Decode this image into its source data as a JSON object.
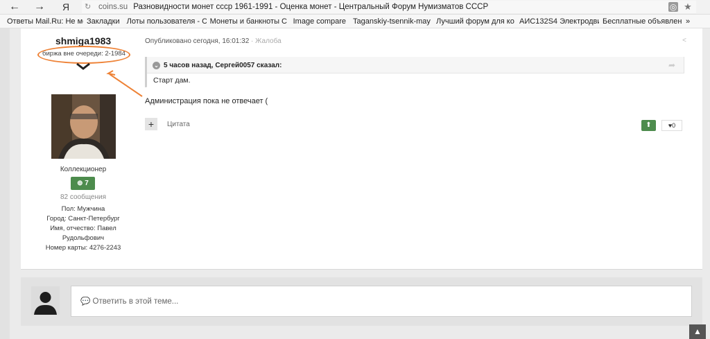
{
  "browser": {
    "back": "←",
    "forward": "→",
    "yandex": "Я",
    "reload": "↻",
    "domain": "coins.su",
    "title": "Разновидности монет ссср 1961-1991 - Оценка монет - Центральный Форум Нумизматов СССР",
    "addon_icon": "◎",
    "star_icon": "★"
  },
  "bookmarks": [
    "Ответы Mail.Ru: Не мо",
    "Закладки",
    "Лоты пользователя - С",
    "Монеты и банкноты С",
    "Image compare",
    "Taganskiy-tsennik-may",
    "Лучший форум для ко",
    "АИС132S4 Электродви",
    "Бесплатные объявлен",
    "»"
  ],
  "author": {
    "username": "shmiga1983",
    "title": "биржа вне очереди: 2-1984",
    "group": "Коллекционер",
    "reputation": "7",
    "posts": "82 сообщения",
    "fields": [
      {
        "label": "Пол:",
        "value": "Мужчина"
      },
      {
        "label": "Город:",
        "value": "Санкт-Петербург"
      },
      {
        "label": "Имя, отчество:",
        "value": "Павел Рудольфович"
      },
      {
        "label": "Номер карты:",
        "value": "4276-2243"
      }
    ]
  },
  "post": {
    "published": "Опубликовано сегодня, 16:01:32",
    "separator": " · ",
    "report": "Жалоба",
    "quote_header": "5 часов назад, Сергей0057 сказал:",
    "quote_text": "Старт дам.",
    "text": "Администрация пока не отвечает (",
    "multiquote": "+",
    "quote_link": "Цитата",
    "likes": "0"
  },
  "reply": {
    "placeholder": "Ответить в этой теме..."
  },
  "colors": {
    "annotation": "#ee8236",
    "reputation": "#4d8c4d"
  }
}
